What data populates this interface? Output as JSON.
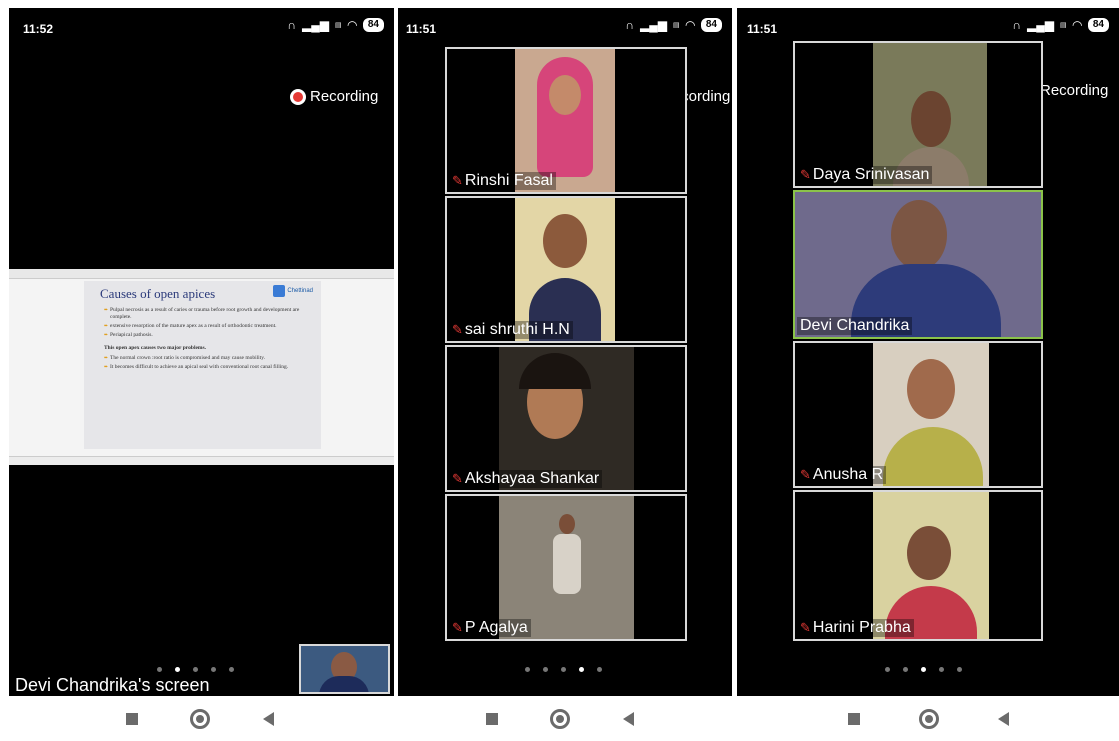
{
  "screens": [
    {
      "time": "11:52",
      "battery": "84",
      "recording_label": "Recording",
      "slide": {
        "title": "Causes of open apices",
        "logo_text": "Chettinad",
        "bullets": [
          "Pulpal necrosis as a result of caries or trauma before root growth and development are complete.",
          "extensive resorption of the mature apex as a result of orthodontic treatment.",
          "Periapical pathosis."
        ],
        "subheading": "This open apex causes two major problems.",
        "problems": [
          "The normal crown :root ratio is compromised and may cause mobility.",
          "It becomes difficult to achieve an apical seal with conventional root canal filling."
        ]
      },
      "share_label": "Devi Chandrika's screen",
      "page_dots": [
        false,
        true,
        false,
        false,
        false
      ]
    },
    {
      "time": "11:51",
      "battery": "84",
      "recording_label": "Recording",
      "participants": [
        "Rinshi Fasal",
        "sai shruthi H.N",
        "Akshayaa Shankar",
        "P Agalya"
      ],
      "page_dots": [
        false,
        false,
        false,
        true,
        false
      ]
    },
    {
      "time": "11:51",
      "battery": "84",
      "recording_label": "Recording",
      "participants": [
        "Daya Srinivasan",
        "Devi Chandrika",
        "Anusha R",
        "Harini Prabha"
      ],
      "page_dots": [
        false,
        false,
        true,
        false,
        false
      ]
    }
  ],
  "icons": {
    "headphones": "headphones-icon",
    "signal": "signal-icon",
    "volte": "volte-icon",
    "wifi": "wifi-icon",
    "mic": "mic-muted-icon"
  },
  "colors": {
    "recording": "#e53935",
    "active_speaker": "#8bc34a",
    "tile_border": "#d9d9d9"
  }
}
